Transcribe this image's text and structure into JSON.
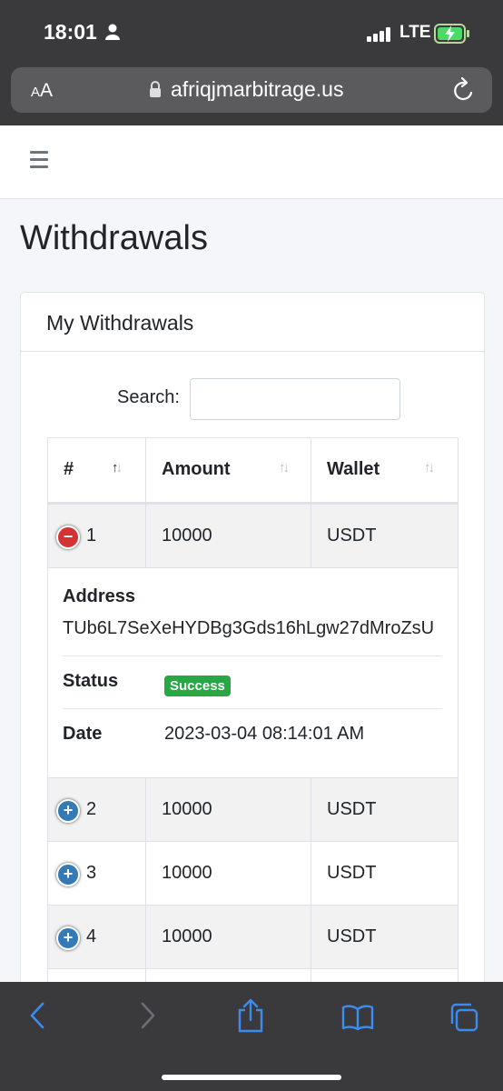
{
  "status_bar": {
    "time": "18:01",
    "network": "LTE"
  },
  "browser": {
    "text_size_label_small": "A",
    "text_size_label_big": "A",
    "url": "afriqjmarbitrage.us"
  },
  "page": {
    "title": "Withdrawals"
  },
  "card": {
    "title": "My Withdrawals"
  },
  "search": {
    "label": "Search:",
    "value": ""
  },
  "table": {
    "headers": [
      "#",
      "Amount",
      "Wallet"
    ],
    "rows": [
      {
        "num": "1",
        "amount": "10000",
        "wallet": "USDT",
        "expanded": true
      },
      {
        "num": "2",
        "amount": "10000",
        "wallet": "USDT",
        "expanded": false
      },
      {
        "num": "3",
        "amount": "10000",
        "wallet": "USDT",
        "expanded": false
      },
      {
        "num": "4",
        "amount": "10000",
        "wallet": "USDT",
        "expanded": false
      }
    ],
    "detail": {
      "address_label": "Address",
      "address_value": "TUb6L7SeXeHYDBg3Gds16hLgw27dMroZsU",
      "status_label": "Status",
      "status_value": "Success",
      "date_label": "Date",
      "date_value": "2023-03-04 08:14:01 AM"
    }
  },
  "colors": {
    "success": "#28a745",
    "collapse_button": "#d33333",
    "expand_button": "#337ab7"
  }
}
